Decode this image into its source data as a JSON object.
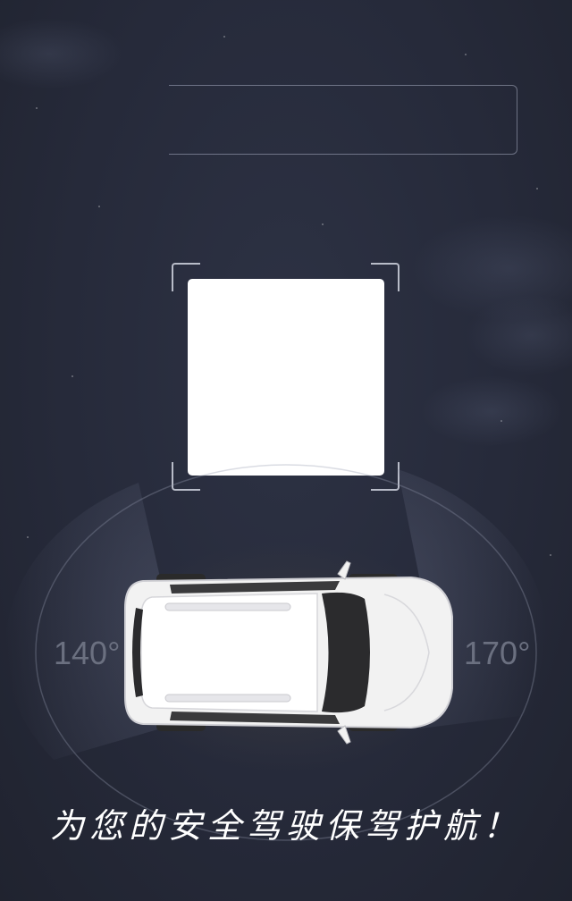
{
  "background": {
    "color": "#262a3a"
  },
  "scanner": {
    "input_box": {
      "value": ""
    },
    "qr_code": {
      "fill": "#ffffff"
    }
  },
  "radar": {
    "rear_angle": "140°",
    "front_angle": "170°"
  },
  "vehicle": {
    "icon": "car-top-view-icon",
    "body_color": "#f2f2f2"
  },
  "slogan": "为您的安全驾驶保驾护航！"
}
